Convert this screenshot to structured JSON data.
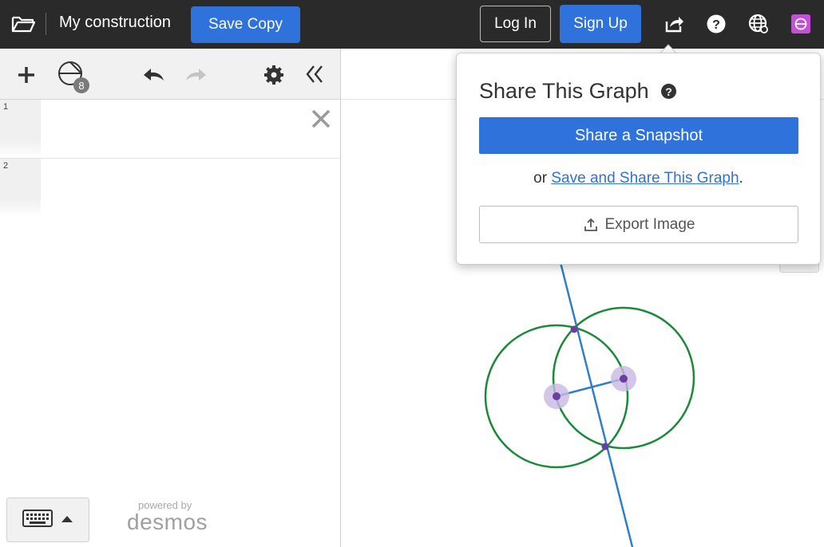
{
  "header": {
    "title": "My construction",
    "save_copy_label": "Save Copy",
    "login_label": "Log In",
    "signup_label": "Sign Up",
    "icons": [
      "folder-icon",
      "share-icon",
      "help-icon",
      "language-globe-icon",
      "geometry-app-icon"
    ]
  },
  "toolbar": {
    "icons": [
      "add-icon",
      "construction-tools-icon",
      "undo-icon",
      "redo-icon",
      "settings-icon",
      "collapse-panel-icon"
    ],
    "tools_badge": "8"
  },
  "expressions": [
    {
      "index": "1"
    },
    {
      "index": "2"
    }
  ],
  "footer": {
    "powered_by": "powered by",
    "brand": "desmos"
  },
  "share_popover": {
    "title": "Share This Graph",
    "help": "?",
    "snapshot_label": "Share a Snapshot",
    "or_text": "or",
    "save_share_link": "Save and Share This Graph",
    "period": ".",
    "export_label": "Export Image"
  },
  "colors": {
    "header_bg": "#2a2a2a",
    "accent_blue": "#2f72dc",
    "circle_green": "#1a8a3a",
    "line_blue": "#2d7fc8",
    "point_purple": "#6b3fa0"
  }
}
